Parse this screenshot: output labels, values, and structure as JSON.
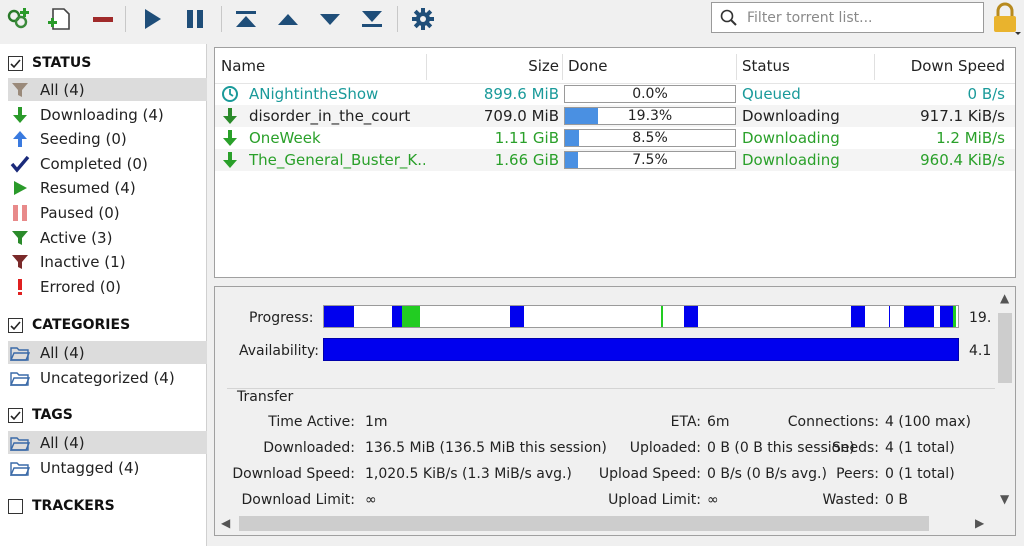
{
  "toolbar": {
    "icons": [
      "add-link-icon",
      "add-file-icon",
      "remove-icon",
      "resume-icon",
      "pause-icon",
      "move-top-icon",
      "move-up-icon",
      "move-down-icon",
      "move-bottom-icon",
      "settings-icon",
      "lock-icon"
    ],
    "search_placeholder": "Filter torrent list..."
  },
  "sidebar": {
    "status": {
      "title": "STATUS",
      "items": [
        {
          "label": "All (4)",
          "icon": "filter-icon",
          "selected": true
        },
        {
          "label": "Downloading (4)",
          "icon": "download-arrow-icon"
        },
        {
          "label": "Seeding (0)",
          "icon": "upload-arrow-icon"
        },
        {
          "label": "Completed (0)",
          "icon": "checkmark-icon"
        },
        {
          "label": "Resumed (4)",
          "icon": "play-icon"
        },
        {
          "label": "Paused (0)",
          "icon": "pause-icon"
        },
        {
          "label": "Active (3)",
          "icon": "filter-active-icon"
        },
        {
          "label": "Inactive (1)",
          "icon": "filter-inactive-icon"
        },
        {
          "label": "Errored (0)",
          "icon": "error-icon"
        }
      ]
    },
    "categories": {
      "title": "CATEGORIES",
      "items": [
        {
          "label": "All (4)",
          "icon": "folder-icon",
          "selected": true
        },
        {
          "label": "Uncategorized (4)",
          "icon": "folder-icon"
        }
      ]
    },
    "tags": {
      "title": "TAGS",
      "items": [
        {
          "label": "All (4)",
          "icon": "folder-icon",
          "selected": true
        },
        {
          "label": "Untagged (4)",
          "icon": "folder-icon"
        }
      ]
    },
    "trackers": {
      "title": "TRACKERS"
    }
  },
  "list": {
    "columns": {
      "name": "Name",
      "size": "Size",
      "done": "Done",
      "status": "Status",
      "down_speed": "Down Speed"
    },
    "rows": [
      {
        "name": "ANightintheShow",
        "size": "899.6 MiB",
        "done": "0.0%",
        "progress": 0.0,
        "status": "Queued",
        "down_speed": "0 B/s",
        "color": "#1a9a9a",
        "icon": "queued-clock-icon"
      },
      {
        "name": "disorder_in_the_court",
        "size": "709.0 MiB",
        "done": "19.3%",
        "progress": 0.193,
        "status": "Downloading",
        "down_speed": "917.1 KiB/s",
        "color": "#222222",
        "icon": "download-arrow-icon"
      },
      {
        "name": "OneWeek",
        "size": "1.11 GiB",
        "done": "8.5%",
        "progress": 0.085,
        "status": "Downloading",
        "down_speed": "1.2 MiB/s",
        "color": "#2aa02a",
        "icon": "download-arrow-icon"
      },
      {
        "name": "The_General_Buster_K...",
        "size": "1.66 GiB",
        "done": "7.5%",
        "progress": 0.075,
        "status": "Downloading",
        "down_speed": "960.4 KiB/s",
        "color": "#2aa02a",
        "icon": "download-arrow-icon"
      }
    ]
  },
  "props": {
    "progress_label": "Progress:",
    "progress_value": "19.",
    "availability_label": "Availability:",
    "availability_value": "4.1",
    "transfer_title": "Transfer",
    "fields": {
      "time_active": {
        "label": "Time Active:",
        "value": "1m"
      },
      "downloaded": {
        "label": "Downloaded:",
        "value": "136.5 MiB (136.5 MiB this session)"
      },
      "download_speed": {
        "label": "Download Speed:",
        "value": "1,020.5 KiB/s (1.3 MiB/s avg.)"
      },
      "download_limit": {
        "label": "Download Limit:",
        "value": "∞"
      },
      "eta": {
        "label": "ETA:",
        "value": "6m"
      },
      "uploaded": {
        "label": "Uploaded:",
        "value": "0 B (0 B this session)"
      },
      "upload_speed": {
        "label": "Upload Speed:",
        "value": "0 B/s (0 B/s avg.)"
      },
      "upload_limit": {
        "label": "Upload Limit:",
        "value": "∞"
      },
      "connections": {
        "label": "Connections:",
        "value": "4 (100 max)"
      },
      "seeds": {
        "label": "Seeds:",
        "value": "4 (1 total)"
      },
      "peers": {
        "label": "Peers:",
        "value": "0 (1 total)"
      },
      "wasted": {
        "label": "Wasted:",
        "value": "0 B"
      }
    }
  },
  "colors": {
    "accent_blue": "#0000ee",
    "piece_green": "#22cc22",
    "progress_fill": "#4a90e2"
  }
}
